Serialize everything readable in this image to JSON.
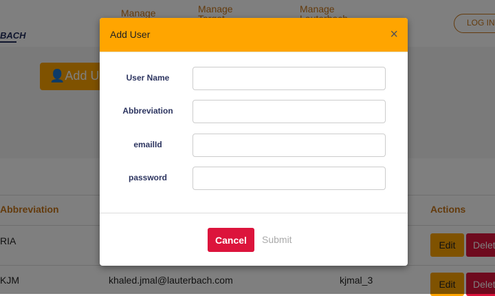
{
  "header": {
    "logo": "BACH",
    "nav": [
      "Manage",
      "Manage\nTarget",
      "Manage\nLauterbach"
    ],
    "login": "LOG IN"
  },
  "page": {
    "add_user": "Add User"
  },
  "table": {
    "headers": [
      "Abbreviation",
      "Actions"
    ],
    "rows": [
      {
        "abbreviation": "RIA",
        "email": "",
        "username": ""
      },
      {
        "abbreviation": "KJM",
        "email": "khaled.jmal@lauterbach.com",
        "username": "kjmal_3"
      }
    ],
    "edit": "Edit",
    "delete": "Delete"
  },
  "modal": {
    "title": "Add User",
    "close": "×",
    "fields": [
      {
        "label": "User Name",
        "value": ""
      },
      {
        "label": "Abbreviation",
        "value": ""
      },
      {
        "label": "emailId",
        "value": ""
      },
      {
        "label": "password",
        "value": ""
      }
    ],
    "cancel": "Cancel",
    "submit": "Submit"
  },
  "colors": {
    "accent": "#ffa500",
    "danger": "#dc143c"
  }
}
